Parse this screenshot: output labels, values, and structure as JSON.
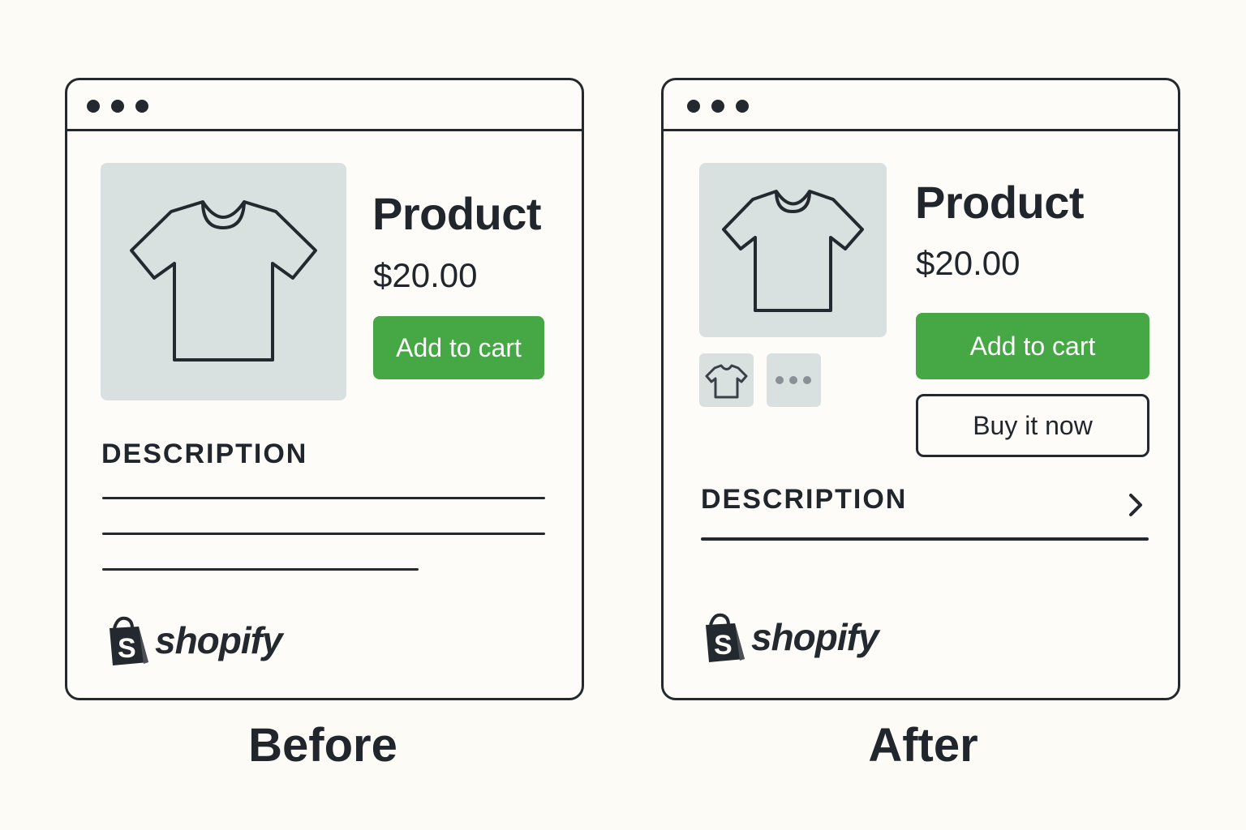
{
  "before": {
    "caption": "Before",
    "product_title": "Product",
    "price": "$20.00",
    "add_to_cart_label": "Add to cart",
    "description_heading": "DESCRIPTION",
    "logo_text": "shopify"
  },
  "after": {
    "caption": "After",
    "product_title": "Product",
    "price": "$20.00",
    "add_to_cart_label": "Add to cart",
    "buy_now_label": "Buy it now",
    "description_heading": "DESCRIPTION",
    "logo_text": "shopify"
  },
  "icons": [
    "tshirt-icon",
    "more-dots-icon",
    "chevron-right-icon",
    "shopify-bag-icon"
  ],
  "colors": {
    "accent_green": "#45a845",
    "image_placeholder": "#d9e0e0",
    "ink": "#23292e",
    "background": "#fcfbf6"
  }
}
